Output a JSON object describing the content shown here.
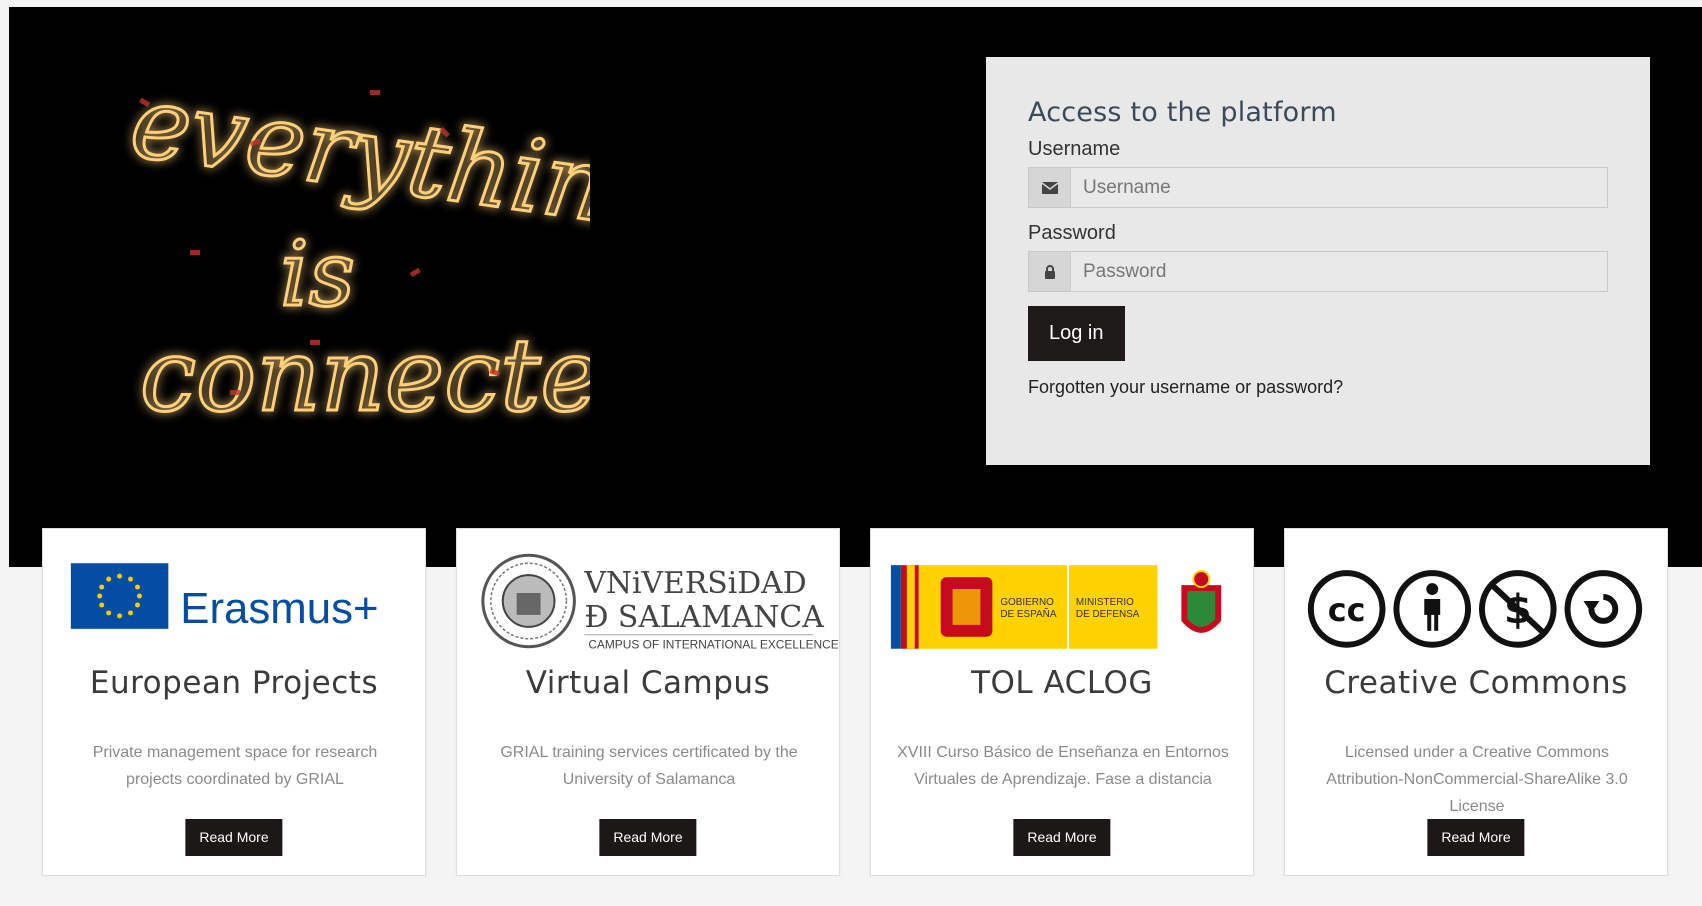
{
  "hero": {
    "neon_lines": [
      "everything",
      "is",
      "connected"
    ]
  },
  "login": {
    "title": "Access to the platform",
    "username_label": "Username",
    "username_placeholder": "Username",
    "password_label": "Password",
    "password_placeholder": "Password",
    "login_button": "Log in",
    "forgot_link": "Forgotten your username or password?"
  },
  "cards": [
    {
      "logo_text": "Erasmus+",
      "title": "European Projects",
      "description": "Private management space for research projects coordinated by GRIAL",
      "button": "Read More"
    },
    {
      "logo_text": "VNiVERSiDAD Ð SALAMANCA",
      "logo_subtext": "CAMPUS OF INTERNATIONAL EXCELLENCE",
      "title": "Virtual Campus",
      "description": "GRIAL training services certificated by the University of Salamanca",
      "button": "Read More"
    },
    {
      "logo_text_1": "GOBIERNO DE ESPAÑA",
      "logo_text_2": "MINISTERIO DE DEFENSA",
      "title": "TOL ACLOG",
      "description": "XVIII Curso Básico de Enseñanza en Entornos Virtuales de Aprendizaje. Fase a distancia",
      "button": "Read More"
    },
    {
      "logo_text": "cc",
      "title": "Creative Commons",
      "description": "Licensed under a Creative Commons Attribution-NonCommercial-ShareAlike 3.0 License",
      "button": "Read More"
    }
  ],
  "colors": {
    "hero_bg": "#000000",
    "panel_bg": "#e8e8e8",
    "button_bg": "#1e1a1a",
    "title_color": "#3a4a5a",
    "eu_blue": "#034ea2",
    "eu_star": "#ffcc00",
    "spain_yellow": "#ffd200",
    "spain_red": "#c60b1e"
  }
}
